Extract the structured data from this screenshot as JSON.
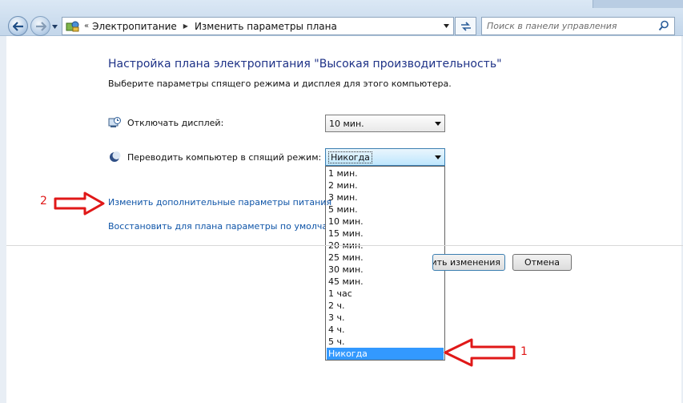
{
  "window": {
    "breadcrumb": [
      "Электропитание",
      "Изменить параметры плана"
    ],
    "breadcrumb_overflow": "«",
    "search": {
      "placeholder": "Поиск в панели управления"
    }
  },
  "page": {
    "title": "Настройка плана электропитания \"Высокая производительность\"",
    "subtitle": "Выберите параметры спящего режима и дисплея для этого компьютера."
  },
  "settings": {
    "display_off": {
      "label": "Отключать дисплей:",
      "value": "10 мин."
    },
    "sleep": {
      "label": "Переводить компьютер в спящий режим:",
      "value": "Никогда"
    }
  },
  "sleep_dropdown": {
    "options": [
      "1 мин.",
      "2 мин.",
      "3 мин.",
      "5 мин.",
      "10 мин.",
      "15 мин.",
      "20 мин.",
      "25 мин.",
      "30 мин.",
      "45 мин.",
      "1 час",
      "2 ч.",
      "3 ч.",
      "4 ч.",
      "5 ч.",
      "Никогда"
    ],
    "selected": "Никогда"
  },
  "links": {
    "advanced": "Изменить дополнительные параметры питания",
    "restore": "Восстановить для плана параметры по умолчанию"
  },
  "buttons": {
    "save": "Сохранить изменения",
    "cancel": "Отмена"
  },
  "annotations": {
    "arrow_1_label": "1",
    "arrow_2_label": "2",
    "color": "#e01818"
  }
}
